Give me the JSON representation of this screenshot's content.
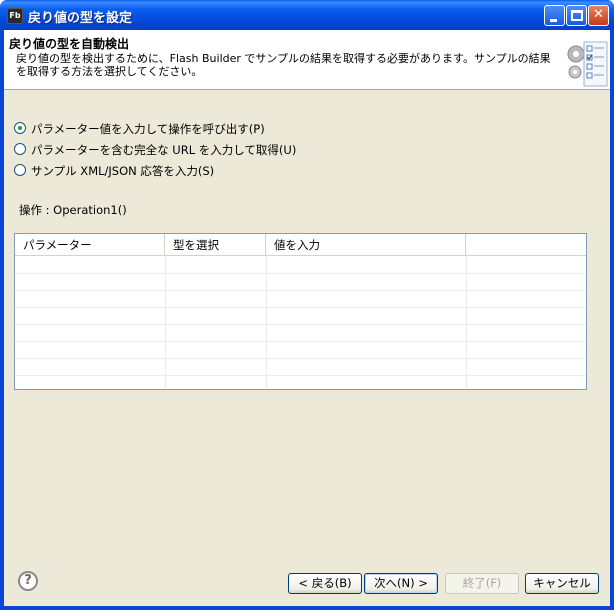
{
  "window": {
    "app_icon": "Fb",
    "title": "戻り値の型を設定",
    "icons": {
      "minimize": "minimize-icon",
      "maximize": "maximize-icon",
      "close": "close-icon"
    }
  },
  "banner": {
    "title": "戻り値の型を自動検出",
    "description": "戻り値の型を検出するために、Flash Builder でサンプルの結果を取得する必要があります。サンプルの結果を取得する方法を選択してください。",
    "image_icon": "wizard-gear-icon"
  },
  "options": [
    {
      "label": "パラメーター値を入力して操作を呼び出す(P)",
      "checked": true
    },
    {
      "label": "パラメーターを含む完全な URL を入力して取得(U)",
      "checked": false
    },
    {
      "label": "サンプル XML/JSON 応答を入力(S)",
      "checked": false
    }
  ],
  "operation": {
    "label": "操作 : Operation1()"
  },
  "table": {
    "columns": [
      "パラメーター",
      "型を選択",
      "値を入力",
      ""
    ],
    "rows": []
  },
  "footer": {
    "help_icon": "help-icon",
    "help_glyph": "?",
    "back": "< 戻る(B)",
    "next": "次へ(N) >",
    "finish": "終了(F)",
    "cancel": "キャンセル"
  }
}
